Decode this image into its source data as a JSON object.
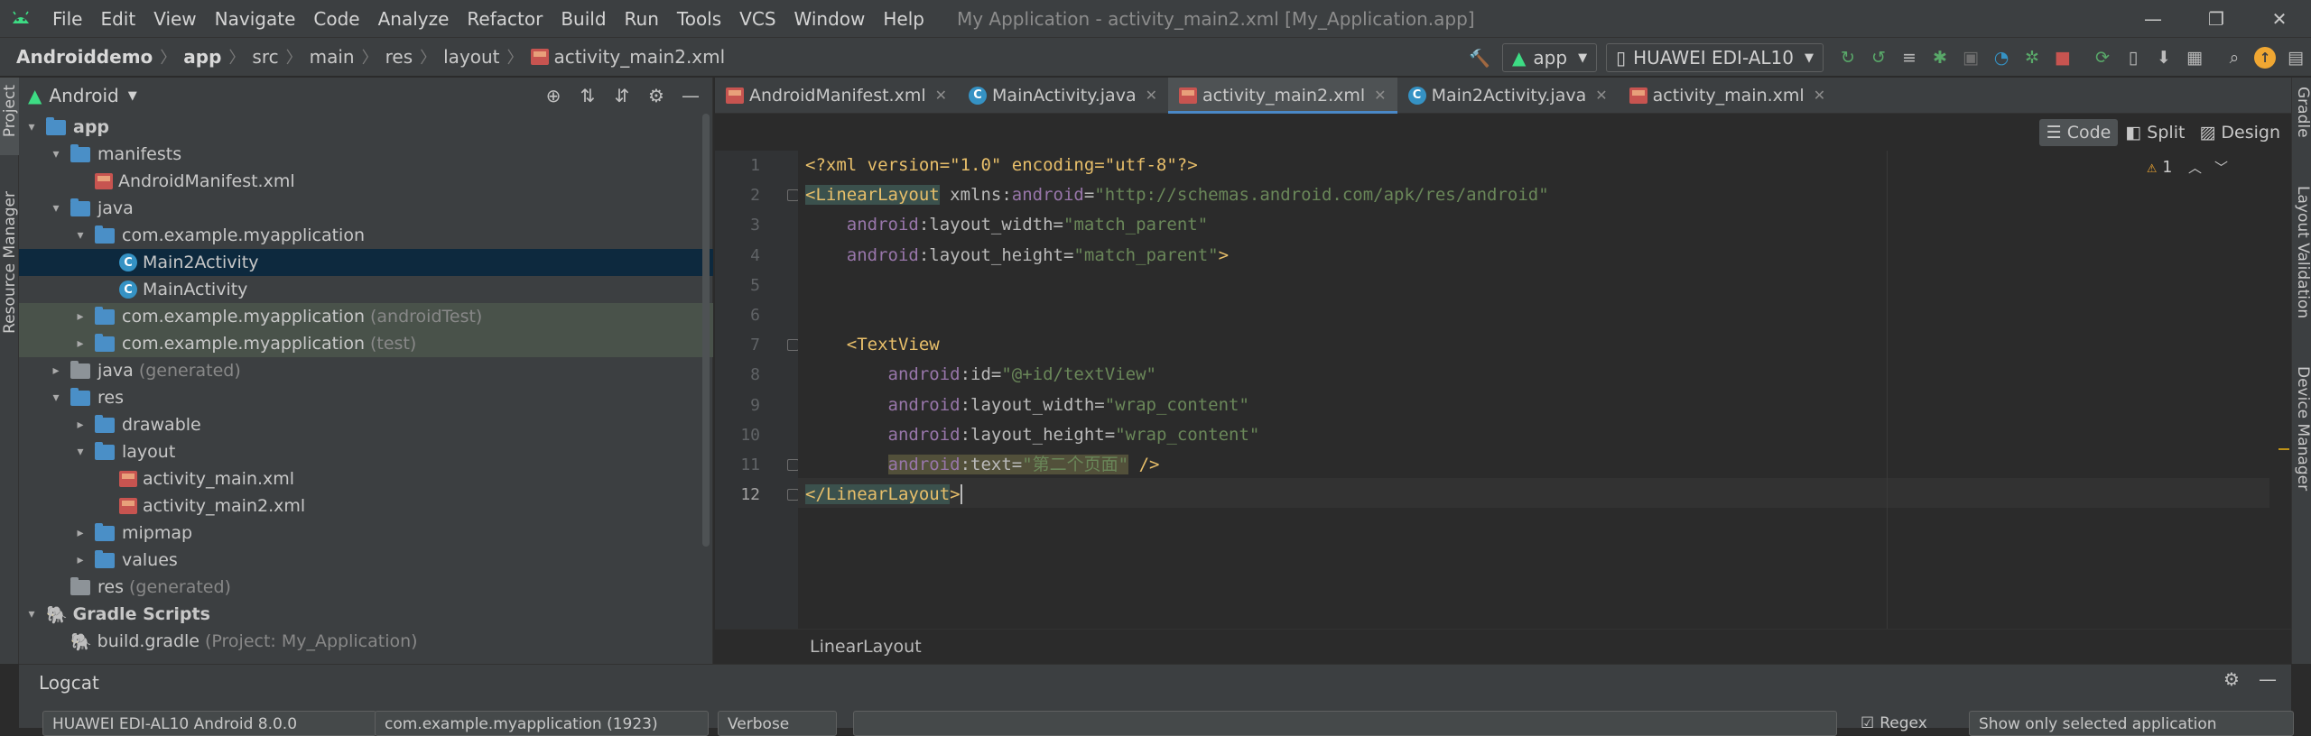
{
  "titlebar": {
    "menu": [
      "File",
      "Edit",
      "View",
      "Navigate",
      "Code",
      "Analyze",
      "Refactor",
      "Build",
      "Run",
      "Tools",
      "VCS",
      "Window",
      "Help"
    ],
    "window_title": "My Application - activity_main2.xml [My_Application.app]",
    "minimize": "—",
    "maximize": "❐",
    "close": "✕"
  },
  "navbar": {
    "crumbs": [
      "Androiddemo",
      "app",
      "src",
      "main",
      "res",
      "layout",
      "activity_main2.xml"
    ],
    "run_config": "app",
    "device": "HUAWEI EDI-AL10"
  },
  "leftstrip": {
    "project": "Project",
    "resource_manager": "Resource Manager"
  },
  "rightstrip": {
    "gradle": "Gradle",
    "layout_validation": "Layout Validation",
    "device_manager": "Device Manager"
  },
  "project_panel": {
    "view_mode": "Android",
    "tree": [
      {
        "label": "app",
        "muted": "",
        "level": 0,
        "arrow": "▾",
        "icon": "folder"
      },
      {
        "label": "manifests",
        "muted": "",
        "level": 1,
        "arrow": "▾",
        "icon": "folder"
      },
      {
        "label": "AndroidManifest.xml",
        "muted": "",
        "level": 2,
        "arrow": "",
        "icon": "xml"
      },
      {
        "label": "java",
        "muted": "",
        "level": 1,
        "arrow": "▾",
        "icon": "folder"
      },
      {
        "label": "com.example.myapplication",
        "muted": "",
        "level": 2,
        "arrow": "▾",
        "icon": "folder"
      },
      {
        "label": "Main2Activity",
        "muted": "",
        "level": 3,
        "arrow": "",
        "icon": "class"
      },
      {
        "label": "MainActivity",
        "muted": "",
        "level": 3,
        "arrow": "",
        "icon": "class"
      },
      {
        "label": "com.example.myapplication",
        "muted": "(androidTest)",
        "level": 2,
        "arrow": "▸",
        "icon": "folder"
      },
      {
        "label": "com.example.myapplication",
        "muted": "(test)",
        "level": 2,
        "arrow": "▸",
        "icon": "folder"
      },
      {
        "label": "java",
        "muted": "(generated)",
        "level": 1,
        "arrow": "▸",
        "icon": "folder"
      },
      {
        "label": "res",
        "muted": "",
        "level": 1,
        "arrow": "▾",
        "icon": "folder"
      },
      {
        "label": "drawable",
        "muted": "",
        "level": 2,
        "arrow": "▸",
        "icon": "folder"
      },
      {
        "label": "layout",
        "muted": "",
        "level": 2,
        "arrow": "▾",
        "icon": "folder"
      },
      {
        "label": "activity_main.xml",
        "muted": "",
        "level": 3,
        "arrow": "",
        "icon": "xml"
      },
      {
        "label": "activity_main2.xml",
        "muted": "",
        "level": 3,
        "arrow": "",
        "icon": "xml"
      },
      {
        "label": "mipmap",
        "muted": "",
        "level": 2,
        "arrow": "▸",
        "icon": "folder"
      },
      {
        "label": "values",
        "muted": "",
        "level": 2,
        "arrow": "▸",
        "icon": "folder"
      },
      {
        "label": "res",
        "muted": "(generated)",
        "level": 1,
        "arrow": "",
        "icon": "folder"
      },
      {
        "label": "Gradle Scripts",
        "muted": "",
        "level": 0,
        "arrow": "▾",
        "icon": "gradle"
      },
      {
        "label": "build.gradle",
        "muted": "(Project: My_Application)",
        "level": 1,
        "arrow": "",
        "icon": "gradle"
      }
    ]
  },
  "editor": {
    "tabs": [
      {
        "label": "AndroidManifest.xml",
        "icon": "xml",
        "active": false
      },
      {
        "label": "MainActivity.java",
        "icon": "class",
        "active": false
      },
      {
        "label": "activity_main2.xml",
        "icon": "xml",
        "active": true
      },
      {
        "label": "Main2Activity.java",
        "icon": "class",
        "active": false
      },
      {
        "label": "activity_main.xml",
        "icon": "xml",
        "active": false
      }
    ],
    "modes": {
      "code": "Code",
      "split": "Split",
      "design": "Design"
    },
    "warning_count": "1",
    "line_numbers": [
      "1",
      "2",
      "3",
      "4",
      "5",
      "6",
      "7",
      "8",
      "9",
      "10",
      "11",
      "12"
    ],
    "code_lines": [
      [
        [
          "pi",
          "<?xml version=\"1.0\" encoding=\"utf-8\"?>"
        ]
      ],
      [
        [
          "tagm",
          "<LinearLayout"
        ],
        [
          "attr",
          " xmlns:"
        ],
        [
          "ns",
          "android"
        ],
        [
          "attr",
          "="
        ],
        [
          "val",
          "\"http://schemas.android.com/apk/res/android\""
        ]
      ],
      [
        [
          "attr",
          "    "
        ],
        [
          "ns",
          "android"
        ],
        [
          "attr",
          ":layout_width="
        ],
        [
          "val",
          "\"match_parent\""
        ]
      ],
      [
        [
          "attr",
          "    "
        ],
        [
          "ns",
          "android"
        ],
        [
          "attr",
          ":layout_height="
        ],
        [
          "val",
          "\"match_parent\""
        ],
        [
          "tag",
          ">"
        ]
      ],
      [],
      [],
      [
        [
          "attr",
          "    "
        ],
        [
          "tag",
          "<TextView"
        ]
      ],
      [
        [
          "attr",
          "        "
        ],
        [
          "ns",
          "android"
        ],
        [
          "attr",
          ":id="
        ],
        [
          "val",
          "\"@+id/textView\""
        ]
      ],
      [
        [
          "attr",
          "        "
        ],
        [
          "ns",
          "android"
        ],
        [
          "attr",
          ":layout_width="
        ],
        [
          "val",
          "\"wrap_content\""
        ]
      ],
      [
        [
          "attr",
          "        "
        ],
        [
          "ns",
          "android"
        ],
        [
          "attr",
          ":layout_height="
        ],
        [
          "val",
          "\"wrap_content\""
        ]
      ],
      [
        [
          "attr",
          "        "
        ],
        [
          "nsw",
          "android"
        ],
        [
          "attrw",
          ":text="
        ],
        [
          "valw",
          "\"第二个页面\""
        ],
        [
          "tag",
          " />"
        ]
      ],
      [
        [
          "tagm",
          "</LinearLayout"
        ],
        [
          "tag",
          ">"
        ]
      ]
    ],
    "breadcrumb": "LinearLayout"
  },
  "logcat": {
    "title": "Logcat",
    "device": "HUAWEI EDI-AL10 Android 8.0.0",
    "process": "com.example.myapplication (1923)",
    "level": "Verbose",
    "search_placeholder": "",
    "regex_label": "Regex",
    "filter": "Show only selected application"
  }
}
